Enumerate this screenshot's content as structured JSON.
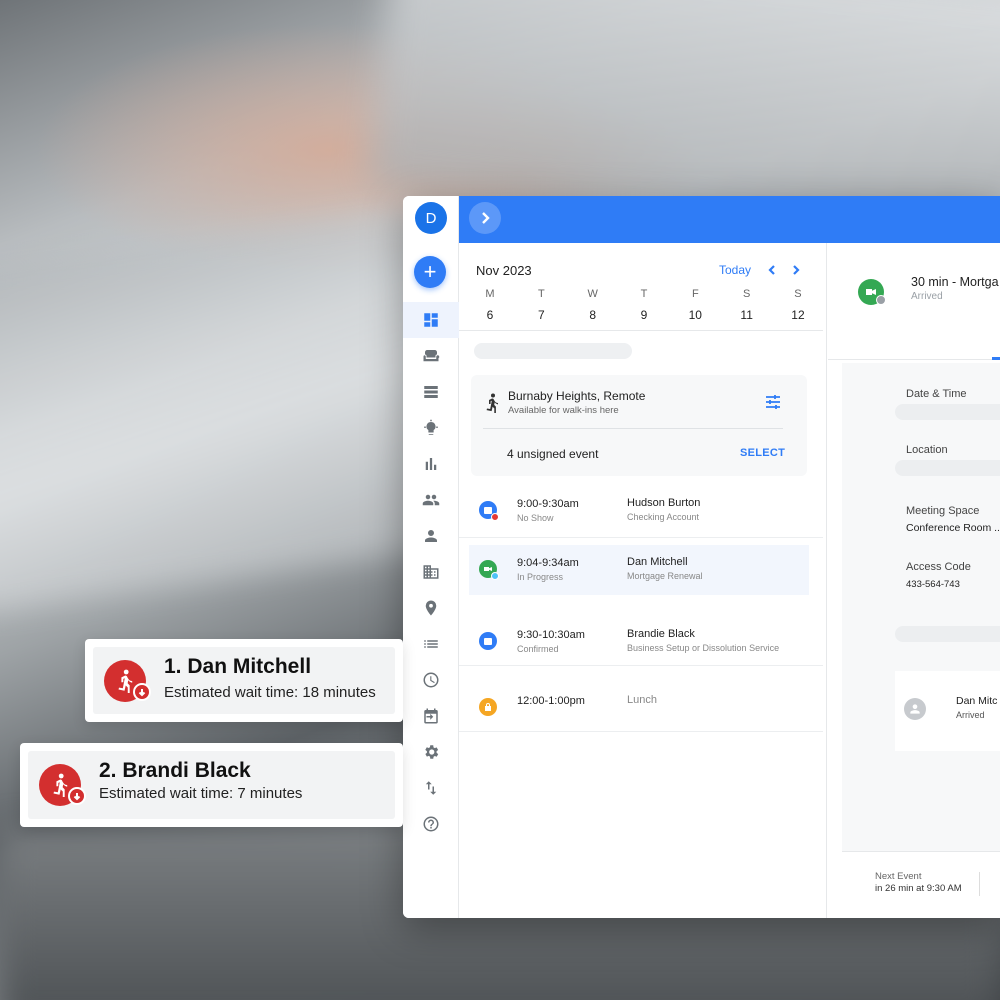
{
  "calendar": {
    "month": "Nov 2023",
    "today_label": "Today",
    "days": [
      {
        "dow": "M",
        "num": "6"
      },
      {
        "dow": "T",
        "num": "7"
      },
      {
        "dow": "W",
        "num": "8"
      },
      {
        "dow": "T",
        "num": "9"
      },
      {
        "dow": "F",
        "num": "10"
      },
      {
        "dow": "S",
        "num": "11"
      },
      {
        "dow": "S",
        "num": "12"
      }
    ]
  },
  "user": {
    "initial": "D"
  },
  "location": {
    "name": "Burnaby Heights, Remote",
    "subtitle": "Available for walk-ins here",
    "unsigned": "4 unsigned event",
    "select_label": "SELECT"
  },
  "events": [
    {
      "time": "9:00-9:30am",
      "status": "No Show",
      "who": "Hudson Burton",
      "service": "Checking Account",
      "icon_color": "#2f7cf6",
      "dot_color": "#e53935"
    },
    {
      "time": "9:04-9:34am",
      "status": "In Progress",
      "who": "Dan Mitchell",
      "service": "Mortgage Renewal",
      "icon_color": "#34a853",
      "dot_color": "#4fc3f7"
    },
    {
      "time": "9:30-10:30am",
      "status": "Confirmed",
      "who": "Brandie Black",
      "service": "Business Setup or Dissolution Service",
      "icon_color": "#2f7cf6",
      "dot_color": ""
    },
    {
      "time": "12:00-1:00pm",
      "status": "",
      "who": "Lunch",
      "service": "",
      "icon_color": "#f5a623",
      "dot_color": ""
    }
  ],
  "detail": {
    "title": "30 min - Mortga",
    "status": "Arrived",
    "date_time_label": "Date & Time",
    "location_label": "Location",
    "meeting_space_label": "Meeting Space",
    "meeting_space_value": "Conference Room ...",
    "access_code_label": "Access Code",
    "access_code_value": "433-564-743",
    "attendee_name": "Dan Mitc",
    "attendee_status": "Arrived",
    "next_event_label": "Next Event",
    "next_event_value": "in 26 min at 9:30 AM"
  },
  "wait_list": [
    {
      "name": "1. Dan Mitchell",
      "estimate": "Estimated wait time: 18 minutes"
    },
    {
      "name": "2. Brandi Black",
      "estimate": "Estimated wait time: 7 minutes"
    }
  ],
  "colors": {
    "accent": "#2f7cf6",
    "alert": "#d32f2f",
    "success": "#34a853"
  },
  "icons": [
    "dashboard-icon",
    "sofa-icon",
    "calendar-view-icon",
    "lightbulb-icon",
    "bar-chart-icon",
    "people-icon",
    "person-icon",
    "building-icon",
    "location-pin-icon",
    "list-icon",
    "clock-icon",
    "calendar-import-icon",
    "gear-icon",
    "swap-vertical-icon",
    "help-icon"
  ]
}
